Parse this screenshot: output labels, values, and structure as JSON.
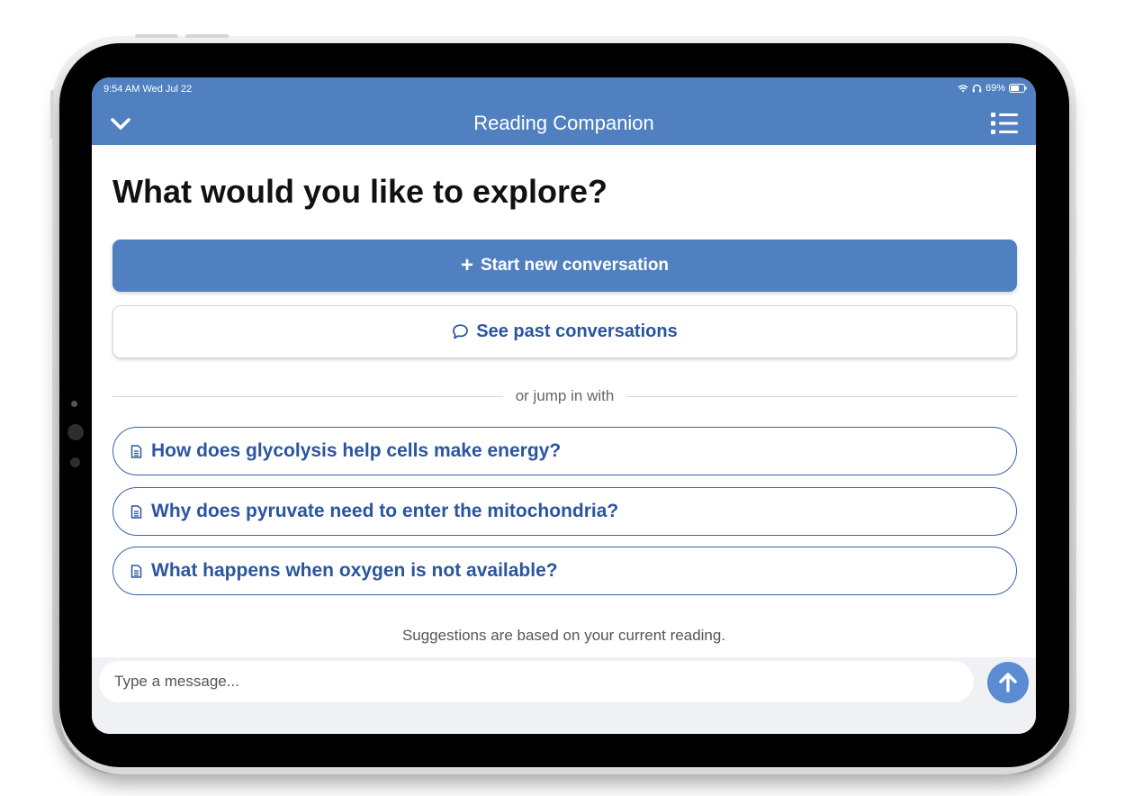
{
  "status_bar": {
    "time": "9:54 AM  Wed Jul 22",
    "battery_percent": "69%"
  },
  "nav": {
    "title": "Reading Companion",
    "left_icon": "chevron-down-icon",
    "right_icon": "list-icon"
  },
  "main": {
    "heading": "What would you like to explore?",
    "start_button_label": "Start new conversation",
    "past_button_label": "See past conversations",
    "divider_text": "or jump in with",
    "suggestions": [
      {
        "label": "How does glycolysis help cells make energy?",
        "icon": "document-icon"
      },
      {
        "label": "Why does pyruvate need to enter the mitochondria?",
        "icon": "document-icon"
      },
      {
        "label": "What happens when oxygen is not available?",
        "icon": "document-icon"
      }
    ],
    "footnote": "Suggestions are based on your current reading."
  },
  "composer": {
    "placeholder": "Type a message...",
    "send_icon": "arrow-up-icon"
  },
  "colors": {
    "accent": "#5080c0",
    "link": "#2a55a0",
    "send": "#5b8bd0"
  }
}
